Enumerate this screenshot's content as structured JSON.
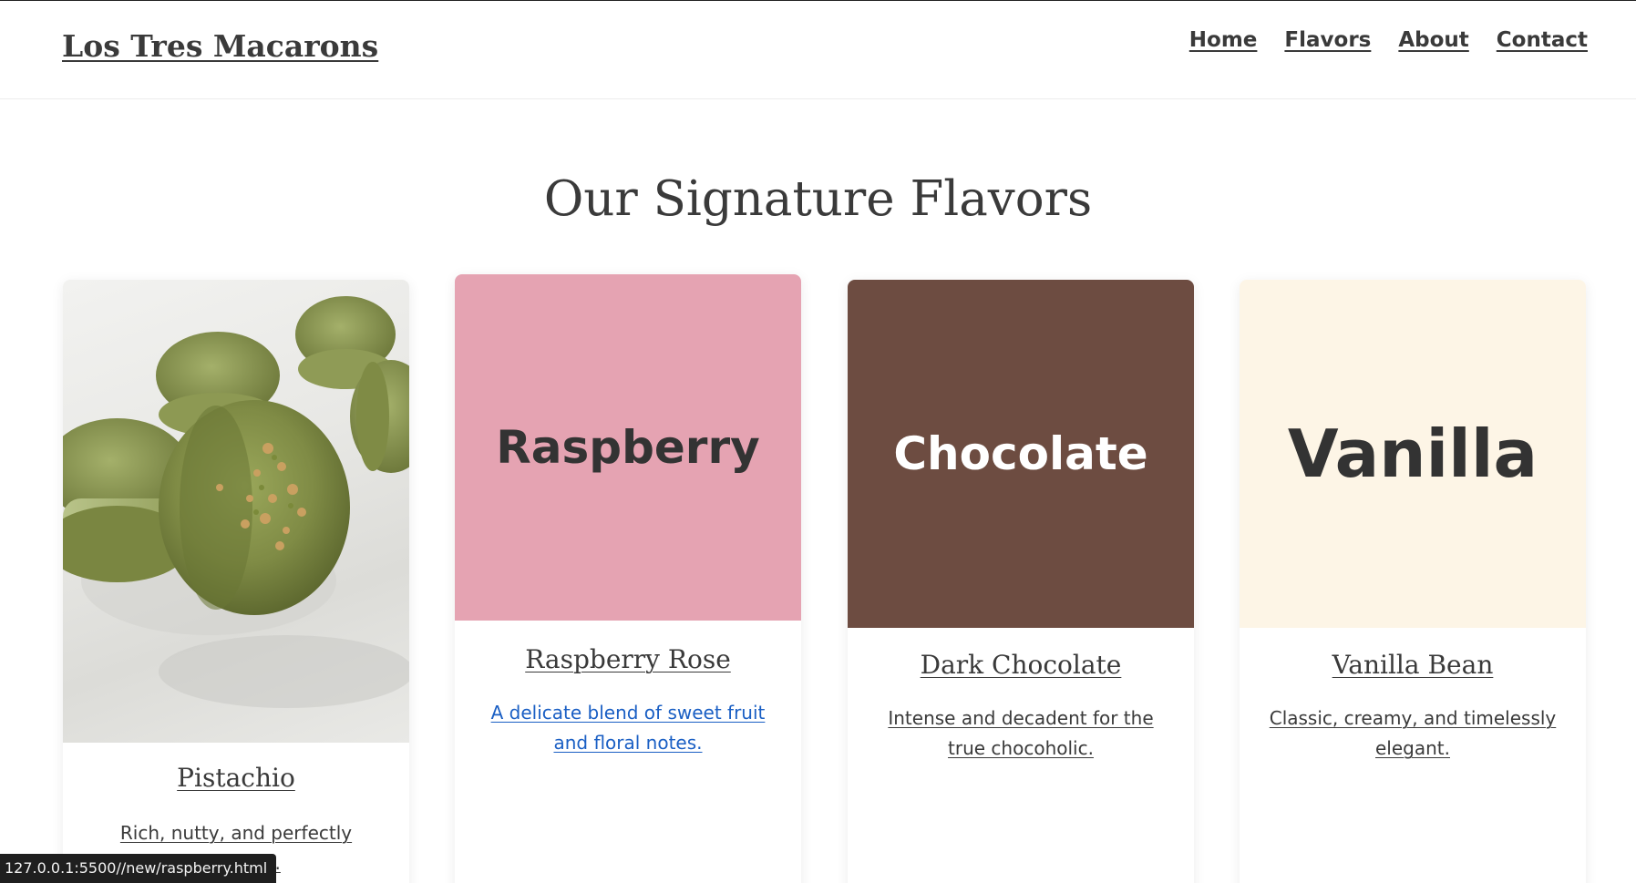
{
  "site": {
    "logo": "Los Tres Macarons"
  },
  "nav": {
    "items": [
      "Home",
      "Flavors",
      "About",
      "Contact"
    ]
  },
  "section": {
    "title": "Our Signature Flavors"
  },
  "cards": [
    {
      "name": "Pistachio",
      "description": "Rich, nutty, and perfectly balanced.",
      "image": "pistachio-macaron-photo"
    },
    {
      "swatch_text": "Raspberry",
      "swatch_color": "#e5a3b2",
      "name": "Raspberry Rose",
      "description": "A delicate blend of sweet fruit and floral notes."
    },
    {
      "swatch_text": "Chocolate",
      "swatch_color": "#6d4c41",
      "name": "Dark Chocolate",
      "description": "Intense and decadent for the true chocoholic."
    },
    {
      "swatch_text": "Vanilla",
      "swatch_color": "#fdf5e6",
      "name": "Vanilla Bean",
      "description": "Classic, creamy, and timelessly elegant."
    }
  ],
  "status_bar": {
    "url": "127.0.0.1:5500//new/raspberry.html"
  },
  "colors": {
    "text": "#333333",
    "link_blue": "#1a5fc4"
  }
}
